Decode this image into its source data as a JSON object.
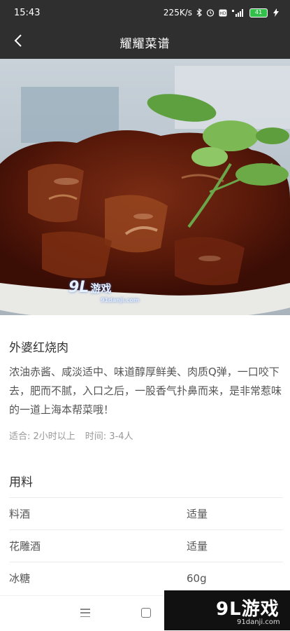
{
  "status_bar": {
    "time": "15:43",
    "net_speed": "225K/s",
    "battery_level": "41",
    "icons": [
      "bluetooth-icon",
      "alarm-icon",
      "hd-icon",
      "signal-4g-icon",
      "battery-icon",
      "charging-icon"
    ]
  },
  "navbar": {
    "title": "耀耀菜谱",
    "back_icon": "chevron-left-icon"
  },
  "hero": {
    "watermark_logo": "9L",
    "watermark_text": "游戏",
    "watermark_url": "91danji.com"
  },
  "recipe": {
    "title": "外婆红烧肉",
    "description": "浓油赤酱、咸淡适中、味道醇厚鲜美、肉质Q弹，一口咬下去，肥而不腻，入口之后，一股香气扑鼻而来，是非常惹味的一道上海本帮菜哦！",
    "suitable": "适合: 2小时以上",
    "time": "时间: 3-4人"
  },
  "ingredients": {
    "section_title": "用料",
    "rows": [
      {
        "name": "料酒",
        "amount": "适量"
      },
      {
        "name": "花雕酒",
        "amount": "适量"
      },
      {
        "name": "冰糖",
        "amount": "60g"
      }
    ]
  },
  "bottom": {
    "brand_logo": "9L游戏",
    "brand_url": "91danji.com"
  },
  "colors": {
    "bar_bg": "#2f2f2f",
    "text_primary": "#333333",
    "text_secondary": "#999999"
  }
}
